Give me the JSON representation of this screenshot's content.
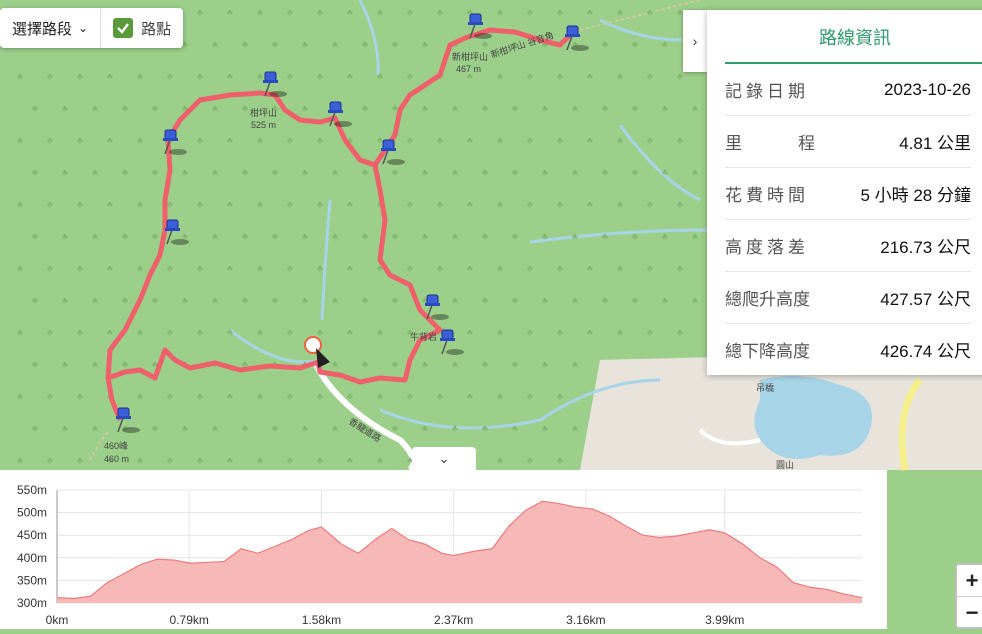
{
  "controls": {
    "segment_select_label": "選擇路段",
    "waypoint_toggle_label": "路點",
    "waypoint_checked": true
  },
  "map_labels": {
    "peak1_name": "柑坪山",
    "peak1_elev": "525 m",
    "peak2_name": "新柑坪山",
    "peak2_elev": "467 m",
    "peak3_name": "460峰",
    "peak3_elev": "460 m",
    "rock_name": "牛背岩",
    "ridge_name": "新柑坪山 谷音角",
    "road_name": "香龍道路",
    "bridge_name": "吊橋",
    "area_name": "圓山"
  },
  "info_panel": {
    "title": "路線資訊",
    "rows": [
      {
        "label": "記錄日期",
        "value": "2023-10-26"
      },
      {
        "label": "里程",
        "value": "4.81 公里"
      },
      {
        "label": "花費時間",
        "value": "5 小時 28 分鐘"
      },
      {
        "label": "高度落差",
        "value": "216.73 公尺"
      },
      {
        "label": "總爬升高度",
        "value": "427.57 公尺"
      },
      {
        "label": "總下降高度",
        "value": "426.74 公尺"
      }
    ]
  },
  "colors": {
    "map_green": "#9ccf8a",
    "track_red": "#f0606a",
    "water_blue": "#a8d4e8",
    "accent_green": "#2e9b6a",
    "elevation_fill": "#f7b8b8",
    "elevation_line": "#ef7b7b"
  },
  "zoom": {
    "in_label": "+",
    "out_label": "−"
  },
  "chart_data": {
    "type": "area",
    "title": "",
    "xlabel": "",
    "ylabel": "",
    "y_tick_labels": [
      "550m",
      "500m",
      "450m",
      "400m",
      "350m",
      "300m"
    ],
    "x_tick_labels": [
      "0km",
      "0.79km",
      "1.58km",
      "2.37km",
      "3.16km",
      "3.99km"
    ],
    "ylim": [
      300,
      550
    ],
    "xlim": [
      0,
      4.81
    ],
    "grid": true,
    "series": [
      {
        "x": [
          0,
          0.1,
          0.2,
          0.3,
          0.4,
          0.5,
          0.6,
          0.7,
          0.8,
          0.9,
          1.0,
          1.1,
          1.2,
          1.3,
          1.4,
          1.5,
          1.58,
          1.7,
          1.8,
          1.9,
          2.0,
          2.1,
          2.2,
          2.3,
          2.37,
          2.5,
          2.6,
          2.7,
          2.8,
          2.9,
          3.0,
          3.1,
          3.2,
          3.3,
          3.4,
          3.5,
          3.6,
          3.7,
          3.8,
          3.9,
          3.99,
          4.1,
          4.2,
          4.3,
          4.4,
          4.5,
          4.6,
          4.7,
          4.81
        ],
        "y": [
          312,
          310,
          315,
          345,
          365,
          385,
          397,
          395,
          388,
          390,
          392,
          420,
          410,
          425,
          440,
          460,
          468,
          430,
          410,
          440,
          465,
          440,
          430,
          410,
          405,
          415,
          420,
          470,
          505,
          525,
          520,
          512,
          508,
          492,
          470,
          450,
          445,
          448,
          455,
          462,
          455,
          430,
          400,
          380,
          345,
          335,
          330,
          320,
          312
        ]
      }
    ]
  }
}
